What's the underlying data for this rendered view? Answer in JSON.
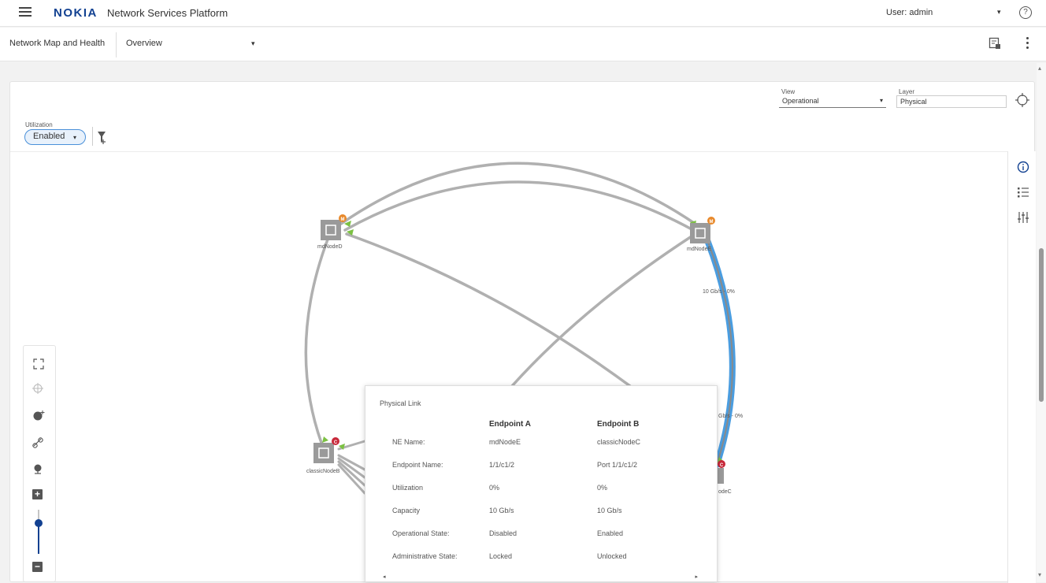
{
  "topbar": {
    "logo": "NOKIA",
    "app_title": "Network Services Platform",
    "user_label": "User: admin",
    "caret": "▾",
    "help_icon": "?"
  },
  "subbar": {
    "breadcrumb": "Network Map and Health",
    "view_select": "Overview",
    "caret": "▾"
  },
  "controls": {
    "view_label": "View",
    "view_value": "Operational",
    "layer_label": "Layer",
    "layer_value": "Physical",
    "utilization_label": "Utilization",
    "utilization_value": "Enabled",
    "caret": "▾"
  },
  "map": {
    "nodes": [
      {
        "name": "mdNodeD",
        "badge": "M",
        "badge_color": "#e8892b"
      },
      {
        "name": "mdNodeE",
        "badge": "M",
        "badge_color": "#e8892b"
      },
      {
        "name": "classicNodeB",
        "badge": "C",
        "badge_color": "#c8283a"
      },
      {
        "name": "classicNodeC",
        "badge": "C",
        "badge_color": "#c8283a"
      }
    ],
    "node_label_c_visible": "odeC",
    "link_labels": [
      "10 Gb/s - 0%",
      "Gb/s - 0%"
    ],
    "selected_link_color": "#4a9de0",
    "link_color": "#b0b0b0"
  },
  "popup": {
    "title": "Physical Link",
    "headers": [
      "",
      "Endpoint A",
      "Endpoint B"
    ],
    "rows": [
      [
        "NE Name:",
        "mdNodeE",
        "classicNodeC"
      ],
      [
        "Endpoint Name:",
        "1/1/c1/2",
        "Port 1/1/c1/2"
      ],
      [
        "Utilization",
        "0%",
        "0%"
      ],
      [
        "Capacity",
        "10 Gb/s",
        "10 Gb/s"
      ],
      [
        "Operational State:",
        "Disabled",
        "Enabled"
      ],
      [
        "Administrative State:",
        "Locked",
        "Unlocked"
      ]
    ],
    "scroll_left": "◂",
    "scroll_right": "▸"
  },
  "zoom": {
    "plus": "+",
    "minus": "−",
    "level": 0.7
  },
  "scroll": {
    "up": "▴",
    "down": "▾"
  },
  "icons": {
    "menu": "hamburger-icon",
    "report": "report-icon",
    "more": "kebab-icon",
    "locate": "crosshair-icon",
    "filter": "filter-add-icon",
    "info": "info-icon",
    "list": "list-icon",
    "settings": "sliders-icon",
    "fit": "fit-screen-icon",
    "select": "select-area-icon",
    "node_add": "node-icon",
    "link_add": "link-icon",
    "geo": "geo-icon"
  }
}
